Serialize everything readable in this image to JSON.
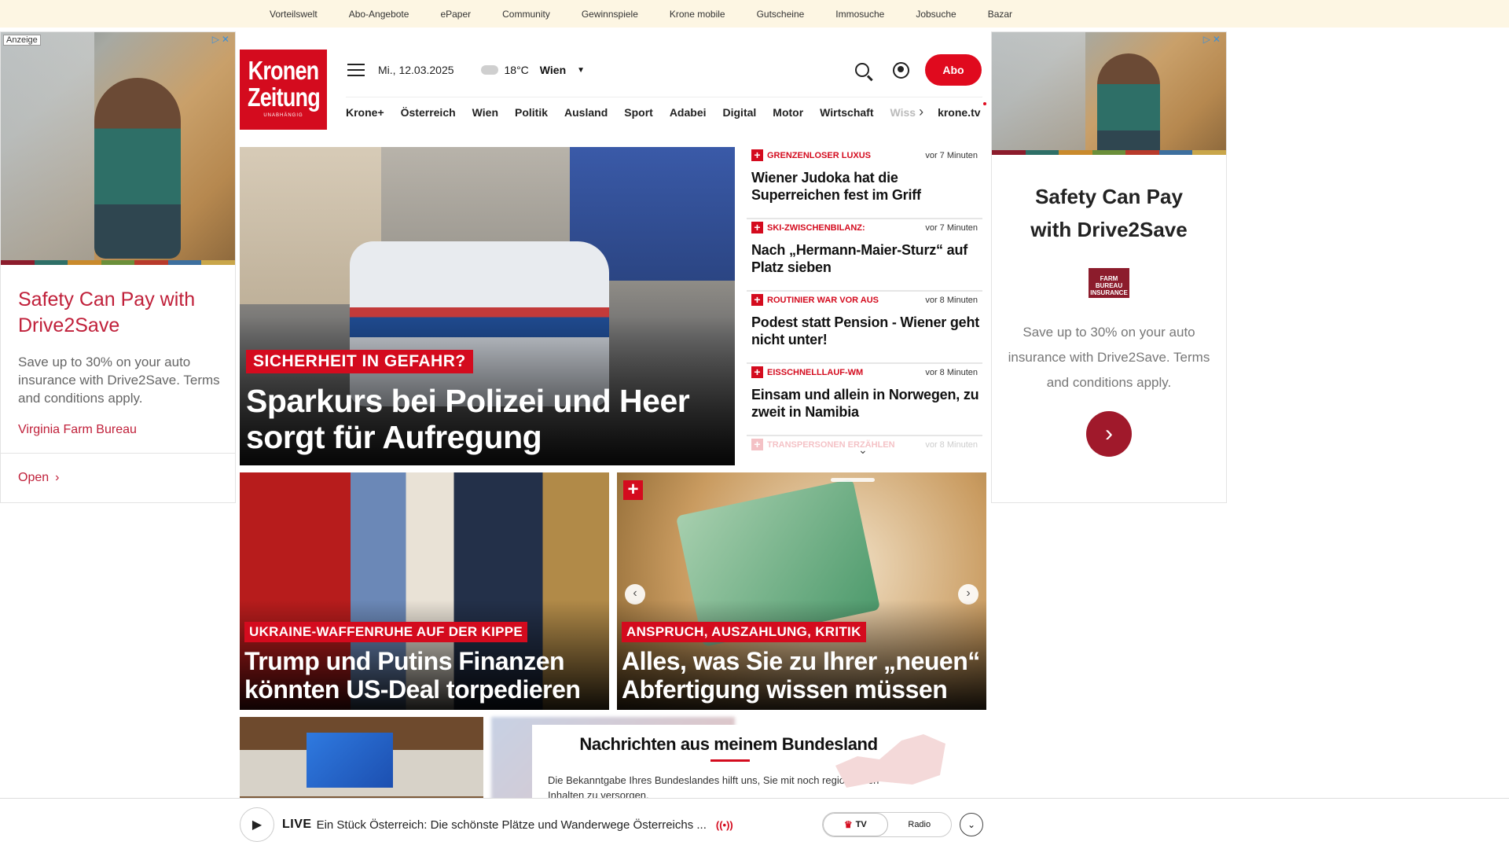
{
  "topbar": {
    "links": [
      "Vorteilswelt",
      "Abo-Angebote",
      "ePaper",
      "Community",
      "Gewinnspiele",
      "Krone mobile",
      "Gutscheine",
      "Immosuche",
      "Jobsuche",
      "Bazar"
    ]
  },
  "ad_left": {
    "label": "Anzeige",
    "title": "Safety Can Pay with Drive2Save",
    "body": "Save up to 30% on your auto insurance with Drive2Save. Terms and conditions apply.",
    "advertiser": "Virginia Farm Bureau",
    "cta": "Open",
    "stripe_colors": [
      "#8c1c2c",
      "#2e6f67",
      "#c98a2c",
      "#6b8f3a",
      "#b83a2b",
      "#3d6f9e",
      "#c9a64a"
    ]
  },
  "ad_right": {
    "title_line1": "Safety Can Pay",
    "title_line2": "with Drive2Save",
    "logo_text": "FARM BUREAU INSURANCE",
    "body": "Save up to 30% on your auto insurance with Drive2Save. Terms and conditions apply."
  },
  "header": {
    "logo_line1": "Kronen",
    "logo_line2": "Zeitung",
    "logo_tagline": "UNABHÄNGIG",
    "date": "Mi., 12.03.2025",
    "temperature": "18°C",
    "city": "Wien",
    "abo_label": "Abo",
    "icons": [
      "menu-icon",
      "cloud-icon",
      "chevron-down-icon",
      "search-icon",
      "user-icon"
    ]
  },
  "nav": {
    "items": [
      "Krone+",
      "Österreich",
      "Wien",
      "Politik",
      "Ausland",
      "Sport",
      "Adabei",
      "Digital",
      "Motor",
      "Wirtschaft"
    ],
    "faded_item": "Wiss",
    "tv_label": "krone.tv"
  },
  "hero": {
    "kicker": "SICHERHEIT IN GEFAHR?",
    "headline": "Sparkurs bei Polizei und Heer sorgt für Aufregung"
  },
  "side_news": [
    {
      "kicker": "GRENZENLOSER LUXUS",
      "time": "vor 7 Minuten",
      "title": "Wiener Judoka hat die Superreichen fest im Griff"
    },
    {
      "kicker": "SKI-ZWISCHENBILANZ:",
      "time": "vor 7 Minuten",
      "title": "Nach „Hermann-Maier-Sturz“ auf Platz sieben"
    },
    {
      "kicker": "ROUTINIER WAR VOR AUS",
      "time": "vor 8 Minuten",
      "title": "Podest statt Pension - Wiener geht nicht unter!"
    },
    {
      "kicker": "EISSCHNELLLAUF-WM",
      "time": "vor 8 Minuten",
      "title": "Einsam und allein in Norwegen, zu zweit in Namibia"
    },
    {
      "kicker": "TRANSPERSONEN ERZÄHLEN",
      "time": "vor 8 Minuten",
      "title": ""
    }
  ],
  "cards": [
    {
      "kicker": "UKRAINE-WAFFENRUHE AUF DER KIPPE",
      "headline": "Trump und Putins Finanzen könnten US-Deal torpedieren"
    },
    {
      "kicker": "ANSPRUCH, AUSZAHLUNG, KRITIK",
      "headline": "Alles, was Sie zu Ihrer „neuen“ Abfertigung wissen müssen"
    }
  ],
  "bundesland": {
    "title": "Nachrichten aus meinem Bundesland",
    "text": "Die Bekanntgabe Ihres Bundeslandes hilft uns, Sie mit noch regionaleren Inhalten zu versorgen."
  },
  "live": {
    "label": "LIVE",
    "text": "Ein Stück Österreich: Die schönste Plätze und Wanderwege Österreichs ...",
    "tv": "TV",
    "radio": "Radio"
  },
  "colors": {
    "brand": "#d40b1e",
    "topbar_bg": "#fdf6e3",
    "ad_accent": "#c0203a"
  }
}
